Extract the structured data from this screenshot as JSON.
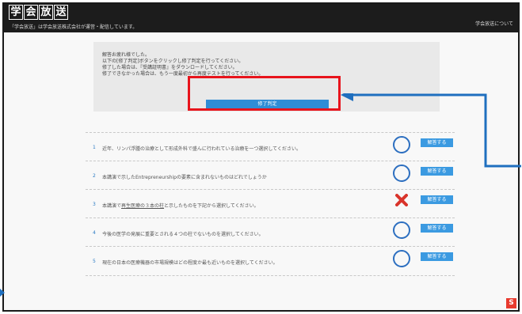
{
  "header": {
    "logo_chars": [
      "学",
      "会",
      "放",
      "送"
    ],
    "tagline": "「学会放送」は学会放送株式会社が運営・配信しています。",
    "about_link": "学会放送について"
  },
  "message": {
    "lines": [
      "解答お疲れ様でした。",
      "以下の[修了判定]ボタンをクリックし修了判定を行ってください。",
      "修了した場合は、『受講証明書』をダウンロードしてください。",
      "修了できなかった場合は、もう一度最初から再度テストを行ってください。"
    ],
    "finish_button": "修了判定"
  },
  "questions": [
    {
      "num": "1",
      "text": "近年、リンパ浮腫の治療として形成外科で盛んに行われている治療を一つ選択してください。",
      "result": "correct",
      "answer_label": "解答する"
    },
    {
      "num": "2",
      "text": "本講演で示したEntrepreneurshipの要素に含まれないものはどれでしょうか",
      "result": "correct",
      "answer_label": "解答する"
    },
    {
      "num": "3",
      "text_before": "本講演で",
      "text_underlined": "再生医療の３本の柱",
      "text_after": "と示したものを下記から選択してください。",
      "result": "incorrect",
      "answer_label": "解答する"
    },
    {
      "num": "4",
      "text": "今後の医学の発展に重要とされる４つの柱でないものを選択してください。",
      "result": "correct",
      "answer_label": "解答する"
    },
    {
      "num": "5",
      "text": "現在の日本の医療機器の市場規模はどの程度か最も近いものを選択してください。",
      "result": "correct",
      "answer_label": "解答する"
    }
  ],
  "colors": {
    "header_bg": "#1c1c1c",
    "accent_blue": "#3b9ae1",
    "highlight_red": "#e8141c",
    "arrow_blue": "#1f6fbf",
    "incorrect_red": "#d9342b"
  },
  "icons": {
    "correct": "circle-icon",
    "incorrect": "cross-icon",
    "arrow": "arrow-left-icon",
    "corner": "app-logo-icon"
  }
}
